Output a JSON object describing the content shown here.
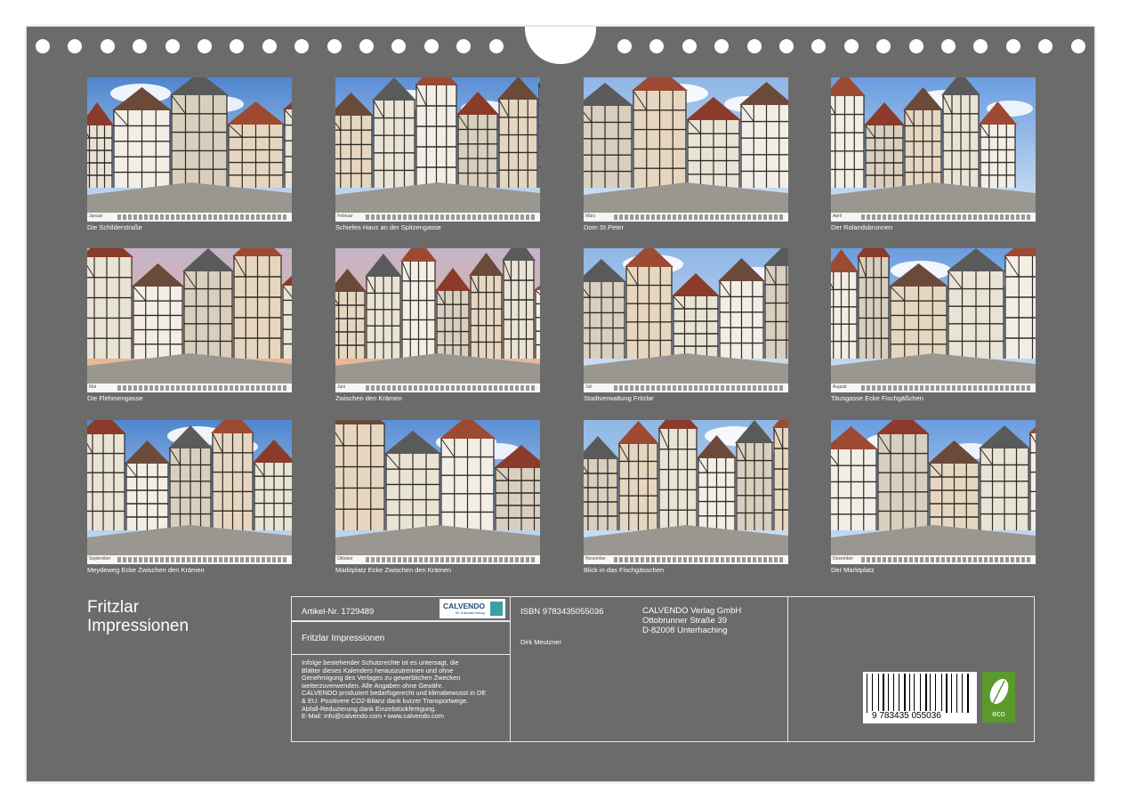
{
  "months": [
    {
      "month": "Januar",
      "caption": "Die Schilderstraße"
    },
    {
      "month": "Februar",
      "caption": "Schiefes Haus an der Spitzengasse"
    },
    {
      "month": "März",
      "caption": "Dom St.Peter"
    },
    {
      "month": "April",
      "caption": "Der Rolandsbrunnen"
    },
    {
      "month": "Mai",
      "caption": "Die Flehmengasse"
    },
    {
      "month": "Juni",
      "caption": "Zwischen den Krämen"
    },
    {
      "month": "Juli",
      "caption": "Stadtverwaltung Fritzlar"
    },
    {
      "month": "August",
      "caption": "Titusgasse Ecke Fischgäßchen"
    },
    {
      "month": "September",
      "caption": "Meydeweg Ecke Zwischen den Krämen"
    },
    {
      "month": "Oktober",
      "caption": "Marktplatz Ecke Zwischen den Krämen"
    },
    {
      "month": "November",
      "caption": "Blick in das Fischgässchen"
    },
    {
      "month": "Dezember",
      "caption": "Der Marktplatz"
    }
  ],
  "title_line1": "Fritzlar",
  "title_line2": "Impressionen",
  "info": {
    "artikel": "Artikel-Nr. 1729489",
    "brand": "CALVENDO",
    "brand_sub": "Ihr Kalenderverlag",
    "subtitle": "Fritzlar Impressionen",
    "legal": [
      "Infolge bestehender Schutzrechte ist es untersagt, die",
      "Blätter dieses Kalenders herauszutrennen und ohne",
      "Genehmigung des Verlages zu gewerblichen Zwecken",
      "weiterzuverwenden. Alle Angaben ohne Gewähr.",
      "CALVENDO produziert bedarfsgerecht und klimabewusst in DE",
      "& EU. Positivere CO2-Bilanz dank kurzer Transportwege.",
      "Abfall-Reduzierung dank Einzelstückfertigung.",
      "E-Mail: info@calvendo.com • www.calvendo.com"
    ],
    "isbn": "ISBN 9783435055036",
    "author": "Dirk Meutzner",
    "publisher": [
      "CALVENDO Verlag GmbH",
      "Ottobrunner Straße 39",
      "D-82008 Unterhaching"
    ],
    "barcode_digits": "9 783435 055036",
    "eco_label": "eco"
  },
  "colors": {
    "background": "#6b6b6b",
    "sky": "#6fa3dd",
    "timber": "#2f2a27",
    "plaster": "#e9e3d6",
    "roof": "#8a3b2a",
    "eco_green": "#5a9a2a"
  }
}
